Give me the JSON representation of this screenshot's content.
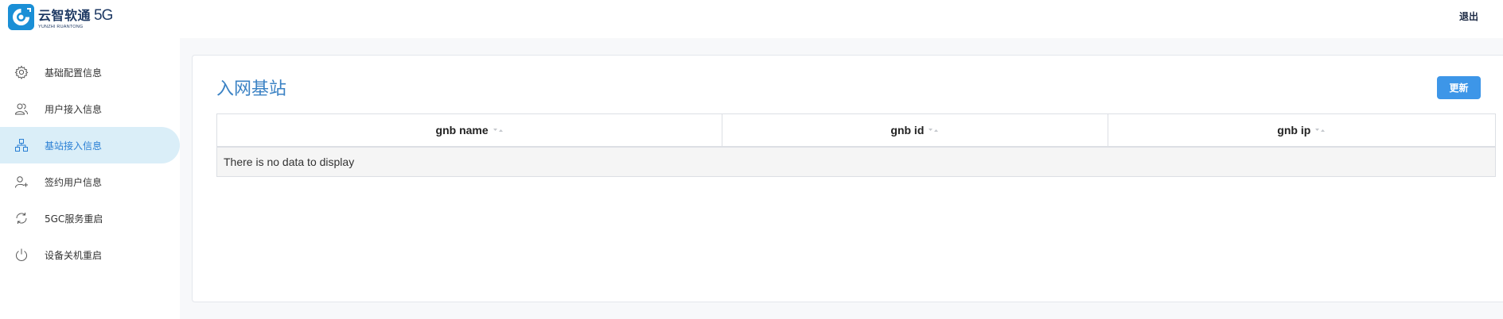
{
  "app": {
    "logo_cn": "云智软通",
    "logo_5g": "5G",
    "logo_sub": "YUNZHI RUANTONG",
    "logout_label": "退出"
  },
  "sidebar": {
    "items": [
      {
        "label": "基础配置信息",
        "icon": "gear-icon",
        "active": false
      },
      {
        "label": "用户接入信息",
        "icon": "users-icon",
        "active": false
      },
      {
        "label": "基站接入信息",
        "icon": "network-nodes-icon",
        "active": true
      },
      {
        "label": "签约用户信息",
        "icon": "user-add-icon",
        "active": false
      },
      {
        "label": "5GC服务重启",
        "icon": "refresh-icon",
        "active": false
      },
      {
        "label": "设备关机重启",
        "icon": "power-icon",
        "active": false
      }
    ]
  },
  "main": {
    "title": "入网基站",
    "update_button": "更新",
    "table": {
      "columns": [
        "gnb name",
        "gnb id",
        "gnb ip"
      ],
      "rows": [],
      "empty_text": "There is no data to display"
    }
  },
  "colors": {
    "accent": "#3d96e8",
    "title": "#3b82c4",
    "active_bg": "#daeef8",
    "active_text": "#2a7fd4"
  }
}
